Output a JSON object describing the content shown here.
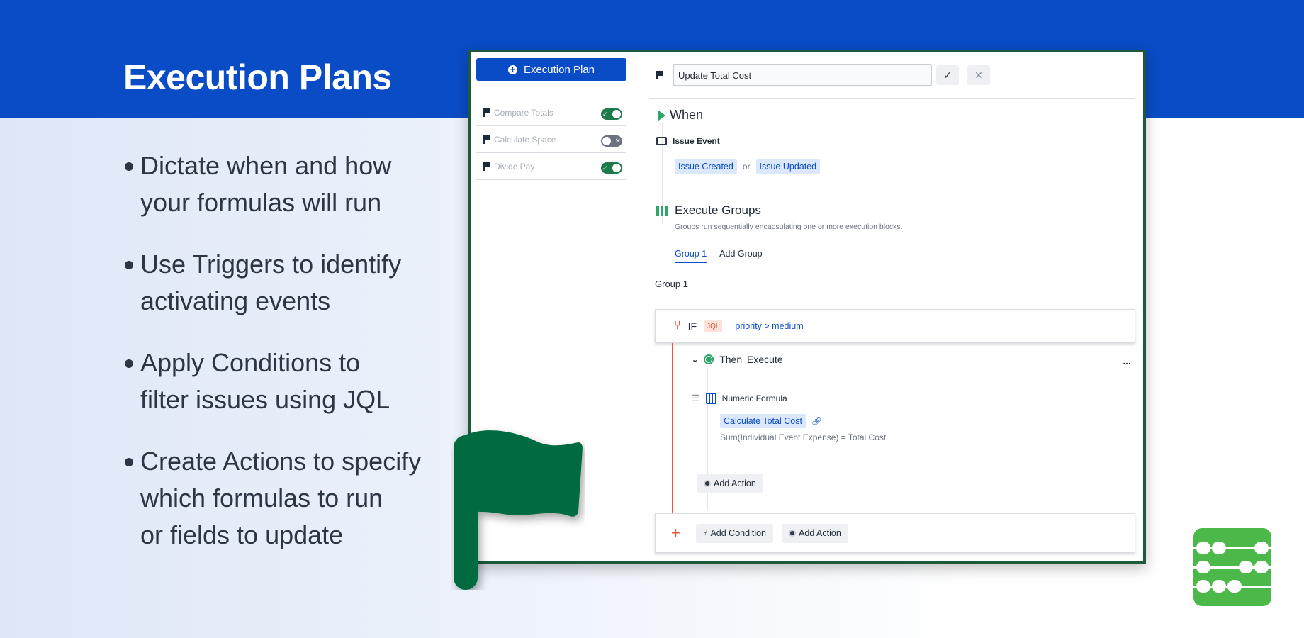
{
  "slide": {
    "title": "Execution Plans",
    "bullets": [
      [
        "Dictate when and how",
        "your formulas will run"
      ],
      [
        "Use Triggers to identify",
        "activating events"
      ],
      [
        "Apply Conditions to",
        "filter issues using JQL"
      ],
      [
        "Create Actions to specify",
        "which formulas to run",
        "or fields to update"
      ]
    ]
  },
  "colors": {
    "brand_blue": "#0a4cc6",
    "flag_green": "#006a40",
    "logo_green": "#4db84a",
    "accent_green": "#2ea66a",
    "accent_orange": "#e8573a"
  },
  "sidebar": {
    "new_plan_label": "Execution Plan",
    "plans": [
      {
        "label": "Compare Totals",
        "enabled": true
      },
      {
        "label": "Calculate Space",
        "enabled": false
      },
      {
        "label": "Divide Pay",
        "enabled": true
      }
    ]
  },
  "editor": {
    "plan_name": "Update Total Cost",
    "when_title": "When",
    "event_title": "Issue Event",
    "event_chips": [
      "Issue Created",
      "Issue Updated"
    ],
    "or_text": "or",
    "execute_title": "Execute Groups",
    "execute_desc": "Groups run sequentially encapsulating one or more execution blocks.",
    "tabs": [
      "Group 1",
      "Add Group"
    ],
    "group_label": "Group 1",
    "if_label": "IF",
    "jql_badge": "JQL",
    "condition": "priority > medium",
    "then_label": "Then Execute",
    "more": "...",
    "formula_title": "Numeric Formula",
    "formula_chip": "Calculate Total Cost",
    "formula_desc": "Sum(Individual Event Expense) = Total Cost",
    "add_action": "Add Action",
    "add_condition": "Add Condition"
  }
}
